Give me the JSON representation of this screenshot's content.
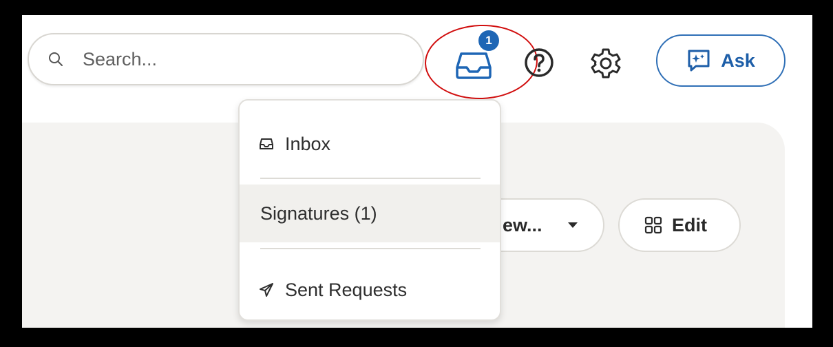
{
  "search": {
    "placeholder": "Search...",
    "value": ""
  },
  "header": {
    "inbox_badge": "1",
    "ask_label": "Ask"
  },
  "toolbar": {
    "view_label": "ew...",
    "edit_label": "Edit"
  },
  "inbox_menu": {
    "items": [
      {
        "label": "Inbox",
        "icon": "tray-icon"
      },
      {
        "label": "Signatures (1)",
        "icon": ""
      },
      {
        "label": "Sent Requests",
        "icon": "paper-plane-icon"
      }
    ]
  },
  "colors": {
    "accent": "#1e66b5",
    "highlight_ring": "#d10e0e",
    "panel_bg": "#f4f3f1"
  }
}
